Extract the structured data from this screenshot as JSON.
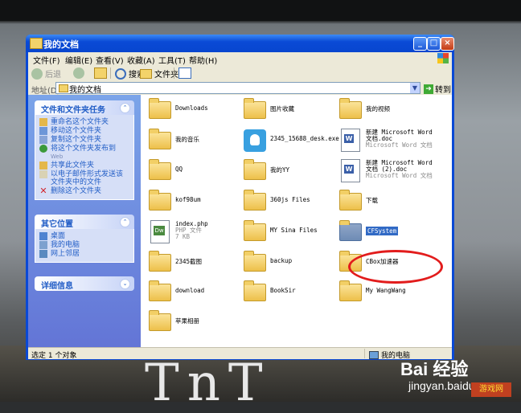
{
  "window": {
    "title": "我的文档"
  },
  "menubar": [
    "文件(F)",
    "编辑(E)",
    "查看(V)",
    "收藏(A)",
    "工具(T)",
    "帮助(H)"
  ],
  "toolbar": {
    "back": "后退",
    "search": "搜索",
    "folders": "文件夹"
  },
  "address": {
    "label": "地址(D)",
    "value": "我的文档",
    "go": "转到"
  },
  "tasks_panel": {
    "title": "文件和文件夹任务",
    "items": [
      {
        "label": "重命名这个文件夹",
        "icon": "rename-icon"
      },
      {
        "label": "移动这个文件夹",
        "icon": "move-icon"
      },
      {
        "label": "复制这个文件夹",
        "icon": "copy-icon"
      },
      {
        "label": "将这个文件夹发布到",
        "sub": "Web",
        "icon": "publish-web-icon"
      },
      {
        "label": "共享此文件夹",
        "icon": "share-icon"
      },
      {
        "label": "以电子邮件形式发送该",
        "sub": "文件夹中的文件",
        "icon": "email-icon"
      },
      {
        "label": "删除这个文件夹",
        "icon": "delete-icon"
      }
    ]
  },
  "places_panel": {
    "title": "其它位置",
    "items": [
      {
        "label": "桌面",
        "icon": "desktop-icon"
      },
      {
        "label": "我的电脑",
        "icon": "my-computer-icon"
      },
      {
        "label": "网上邻居",
        "icon": "network-icon"
      }
    ]
  },
  "details_panel": {
    "title": "详细信息"
  },
  "files": [
    {
      "name": "Downloads",
      "type": "folder"
    },
    {
      "name": "图片收藏",
      "type": "folder"
    },
    {
      "name": "我的视频",
      "type": "folder"
    },
    {
      "name": "我的音乐",
      "type": "folder"
    },
    {
      "name": "2345_15688_desk.exe",
      "type": "exe"
    },
    {
      "name": "新建 Microsoft Word",
      "name2": "文档.doc",
      "meta": "Microsoft Word 文档",
      "type": "doc"
    },
    {
      "name": "QQ",
      "type": "folder"
    },
    {
      "name": "我的YY",
      "type": "folder"
    },
    {
      "name": "新建 Microsoft Word",
      "name2": "文档 (2).doc",
      "meta": "Microsoft Word 文档",
      "type": "doc"
    },
    {
      "name": "kof98um",
      "type": "folder"
    },
    {
      "name": "360js Files",
      "type": "folder"
    },
    {
      "name": "下载",
      "type": "folder"
    },
    {
      "name": "index.php",
      "name2": "PHP 文件",
      "meta": "7 KB",
      "type": "php"
    },
    {
      "name": "MY Sina Files",
      "type": "folder"
    },
    {
      "name": "CFSystem",
      "type": "folder",
      "selected": true
    },
    {
      "name": "2345截图",
      "type": "folder"
    },
    {
      "name": "backup",
      "type": "folder"
    },
    {
      "name": "CBox加速器",
      "type": "folder"
    },
    {
      "name": "download",
      "type": "folder"
    },
    {
      "name": "BookSir",
      "type": "folder"
    },
    {
      "name": "My WangWang",
      "type": "folder"
    },
    {
      "name": "苹果相册",
      "type": "folder"
    }
  ],
  "status": {
    "left": "选定 1 个对象",
    "right": "我的电脑"
  },
  "background": {
    "text": "TnT",
    "watermark1": "Bai 经验",
    "watermark2": "jingyan.baidu",
    "watermark3": "游戏网"
  }
}
